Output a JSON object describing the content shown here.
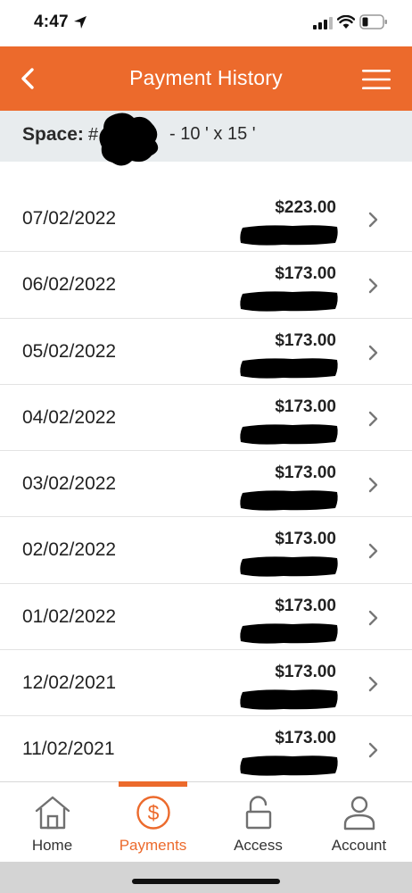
{
  "status_bar": {
    "time": "4:47"
  },
  "header": {
    "title": "Payment History"
  },
  "space": {
    "label": "Space:",
    "prefix": "#",
    "size": "- 10 ' x 15 '"
  },
  "payments": [
    {
      "date": "07/02/2022",
      "amount": "$223.00"
    },
    {
      "date": "06/02/2022",
      "amount": "$173.00"
    },
    {
      "date": "05/02/2022",
      "amount": "$173.00"
    },
    {
      "date": "04/02/2022",
      "amount": "$173.00"
    },
    {
      "date": "03/02/2022",
      "amount": "$173.00"
    },
    {
      "date": "02/02/2022",
      "amount": "$173.00"
    },
    {
      "date": "01/02/2022",
      "amount": "$173.00"
    },
    {
      "date": "12/02/2021",
      "amount": "$173.00"
    },
    {
      "date": "11/02/2021",
      "amount": "$173.00"
    }
  ],
  "tabs": [
    {
      "label": "Home",
      "icon": "home-icon",
      "active": false
    },
    {
      "label": "Payments",
      "icon": "dollar-circle-icon",
      "active": true
    },
    {
      "label": "Access",
      "icon": "unlock-icon",
      "active": false
    },
    {
      "label": "Account",
      "icon": "person-icon",
      "active": false
    }
  ],
  "colors": {
    "brand": "#ec6a2c",
    "space_bar_bg": "#e8ecee",
    "redaction": "#000000"
  }
}
